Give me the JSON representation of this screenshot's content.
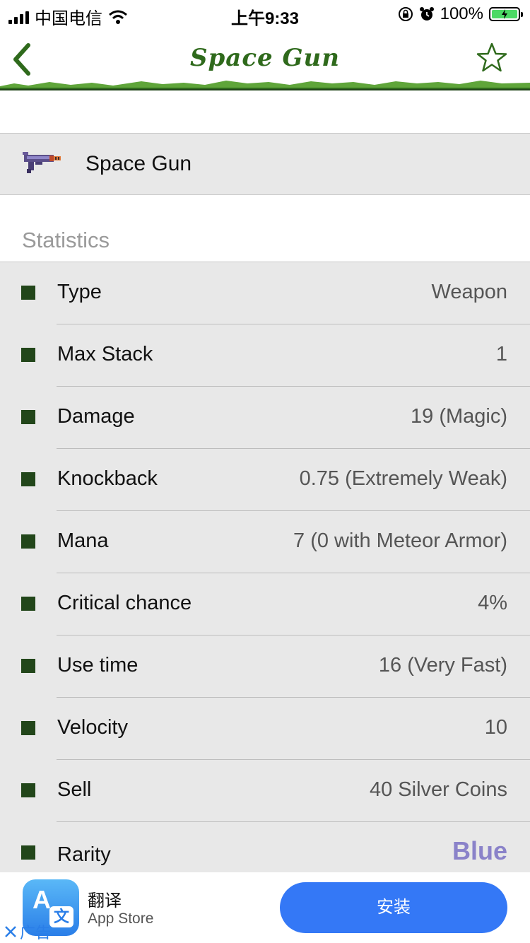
{
  "status_bar": {
    "carrier": "中国电信",
    "time": "上午9:33",
    "battery_percent": "100%"
  },
  "nav": {
    "title": "Space Gun",
    "back_icon": "chevron-left-icon",
    "favorite_icon": "star-outline-icon",
    "accent_color": "#2f6a1c"
  },
  "item": {
    "name": "Space Gun",
    "icon": "space-gun-sprite"
  },
  "statistics": {
    "header": "Statistics",
    "rows": [
      {
        "label": "Type",
        "value": "Weapon"
      },
      {
        "label": "Max Stack",
        "value": "1"
      },
      {
        "label": "Damage",
        "value": "19 (Magic)"
      },
      {
        "label": "Knockback",
        "value": "0.75 (Extremely Weak)"
      },
      {
        "label": "Mana",
        "value": "7 (0 with Meteor Armor)"
      },
      {
        "label": "Critical chance",
        "value": "4%"
      },
      {
        "label": "Use time",
        "value": "16 (Very Fast)"
      },
      {
        "label": "Velocity",
        "value": "10"
      },
      {
        "label": "Sell",
        "value": "40 Silver Coins"
      },
      {
        "label": "Rarity",
        "value": "Blue"
      }
    ],
    "rarity_color": "#8a82c9"
  },
  "ad": {
    "app_name": "翻译",
    "store": "App Store",
    "install_label": "安装",
    "ad_label": "广告",
    "icon_letter": "A",
    "icon_char": "文"
  }
}
